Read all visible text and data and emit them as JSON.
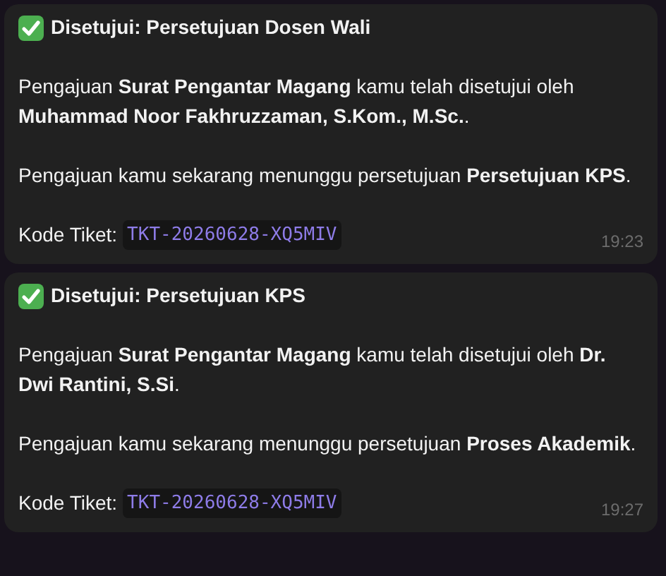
{
  "messages": [
    {
      "title": "Disetujui: Persetujuan Dosen Wali",
      "paragraphs": [
        "Pengajuan **Surat Pengantar Magang** kamu telah disetujui oleh **Muhammad Noor Fakhruzzaman, S.Kom., M.Sc.**.",
        "Pengajuan kamu sekarang menunggu persetujuan **Persetujuan KPS**."
      ],
      "ticket_label": "Kode Tiket:",
      "ticket_code": "TKT-20260628-XQ5MIV",
      "time": "19:23"
    },
    {
      "title": "Disetujui: Persetujuan KPS",
      "paragraphs": [
        "Pengajuan **Surat Pengantar Magang** kamu telah disetujui oleh **Dr. Dwi Rantini, S.Si**.",
        "Pengajuan kamu sekarang menunggu persetujuan **Proses Akademik**."
      ],
      "ticket_label": "Kode Tiket:",
      "ticket_code": "TKT-20260628-XQ5MIV",
      "time": "19:27"
    }
  ]
}
